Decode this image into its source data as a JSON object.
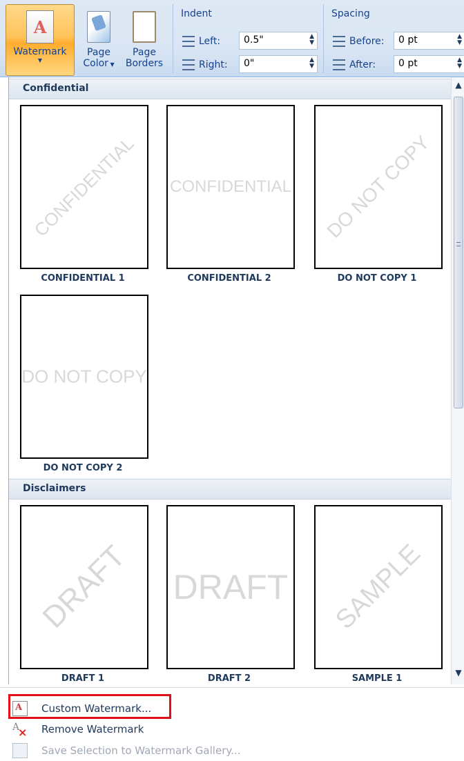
{
  "ribbon": {
    "watermark_label": "Watermark",
    "page_color_label_1": "Page",
    "page_color_label_2": "Color",
    "page_borders_label_1": "Page",
    "page_borders_label_2": "Borders",
    "indent": {
      "title": "Indent",
      "left_label": "Left:",
      "left_value": "0.5\"",
      "right_label": "Right:",
      "right_value": "0\""
    },
    "spacing": {
      "title": "Spacing",
      "before_label": "Before:",
      "before_value": "0 pt",
      "after_label": "After:",
      "after_value": "0 pt"
    }
  },
  "gallery": {
    "categories": [
      {
        "name": "Confidential",
        "items": [
          {
            "caption": "CONFIDENTIAL 1",
            "watermark": "CONFIDENTIAL",
            "orientation": "diagonal"
          },
          {
            "caption": "CONFIDENTIAL 2",
            "watermark": "CONFIDENTIAL",
            "orientation": "horizontal"
          },
          {
            "caption": "DO NOT COPY 1",
            "watermark": "DO NOT COPY",
            "orientation": "diagonal"
          },
          {
            "caption": "DO NOT COPY 2",
            "watermark": "DO NOT COPY",
            "orientation": "horizontal"
          }
        ]
      },
      {
        "name": "Disclaimers",
        "items": [
          {
            "caption": "DRAFT 1",
            "watermark": "DRAFT",
            "orientation": "diagonal"
          },
          {
            "caption": "DRAFT 2",
            "watermark": "DRAFT",
            "orientation": "horizontal"
          },
          {
            "caption": "SAMPLE 1",
            "watermark": "SAMPLE",
            "orientation": "diagonal"
          }
        ]
      }
    ]
  },
  "menu": {
    "custom_watermark": "Custom Watermark...",
    "remove_watermark": "Remove Watermark",
    "save_selection": "Save Selection to Watermark Gallery..."
  },
  "colors": {
    "highlight": "#e0101a",
    "active_button": "#ffc35a"
  }
}
